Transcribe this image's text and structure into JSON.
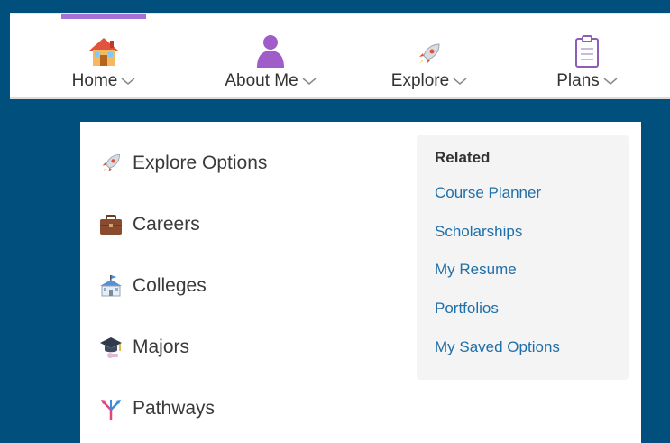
{
  "nav": {
    "items": [
      {
        "label": "Home",
        "icon": "house-icon",
        "active": true
      },
      {
        "label": "About Me",
        "icon": "person-icon",
        "active": false
      },
      {
        "label": "Explore",
        "icon": "rocket-icon",
        "active": false
      },
      {
        "label": "Plans",
        "icon": "clipboard-icon",
        "active": false
      }
    ],
    "accent_color": "#a571d4"
  },
  "menu": {
    "items": [
      {
        "label": "Explore Options",
        "icon": "rocket-icon"
      },
      {
        "label": "Careers",
        "icon": "briefcase-icon"
      },
      {
        "label": "Colleges",
        "icon": "school-building-icon"
      },
      {
        "label": "Majors",
        "icon": "graduation-cap-icon"
      },
      {
        "label": "Pathways",
        "icon": "pathways-icon"
      }
    ]
  },
  "related": {
    "title": "Related",
    "links": [
      "Course Planner",
      "Scholarships",
      "My Resume",
      "Portfolios",
      "My Saved Options"
    ]
  },
  "colors": {
    "background": "#004f7c",
    "link": "#1f6fa8"
  }
}
